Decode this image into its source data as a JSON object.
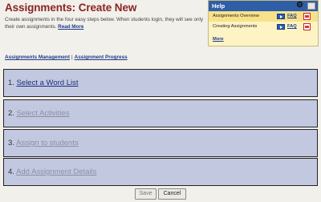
{
  "header": {
    "title": "Assignments: Create New",
    "intro": "Create assignments in the four easy steps below. When students login, they will see only their own assignments.",
    "read_more": "Read More"
  },
  "help": {
    "title": "Help",
    "items": [
      {
        "label": "Assignments Overview",
        "faq": "FAQ"
      },
      {
        "label": "Creating Assignments",
        "faq": "FAQ"
      }
    ],
    "more": "More"
  },
  "subnav": {
    "management": "Assignments Management",
    "separator": "|",
    "progress": "Assignment Progress"
  },
  "steps": [
    {
      "number": "1.",
      "label": "Select a Word List"
    },
    {
      "number": "2.",
      "label": "Select Activities"
    },
    {
      "number": "3.",
      "label": "Assign to students"
    },
    {
      "number": "4.",
      "label": "Add Assignment Details"
    }
  ],
  "buttons": {
    "save": "Save",
    "cancel": "Cancel"
  }
}
